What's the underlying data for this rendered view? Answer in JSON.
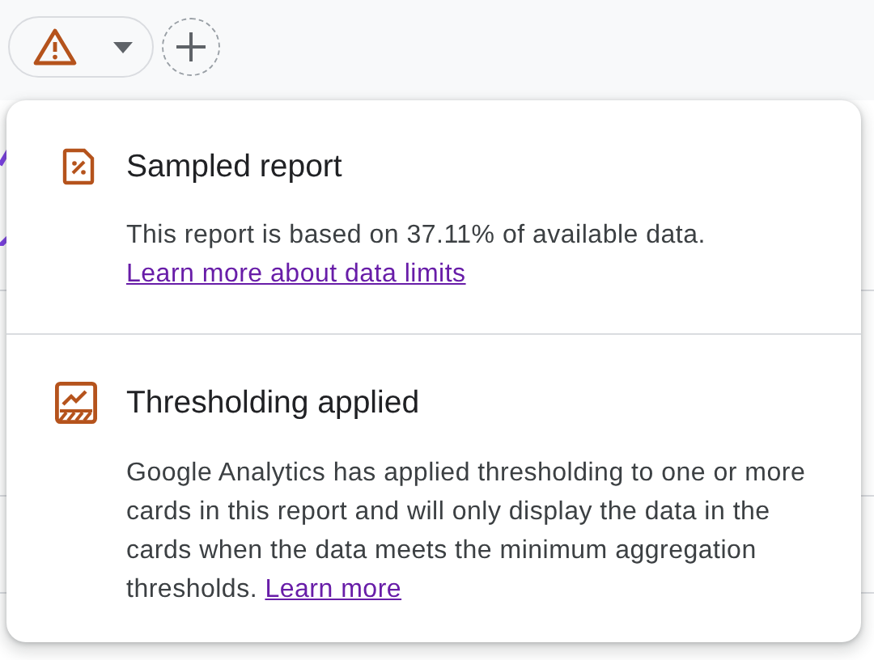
{
  "toolbar": {
    "buttons": [
      {
        "kind": "alert-dropdown"
      },
      {
        "kind": "add"
      }
    ]
  },
  "popup": {
    "sections": [
      {
        "kind": "sampled",
        "title": "Sampled report",
        "body": "This report is based on 37.11% of available data.",
        "link": "Learn more about data limits"
      },
      {
        "kind": "threshold",
        "title": "Thresholding applied",
        "body": "Google Analytics has applied thresholding to one or more cards in this report and will only display the data in the cards when the data meets the minimum aggregation thresholds.",
        "link": "Learn more"
      }
    ]
  }
}
